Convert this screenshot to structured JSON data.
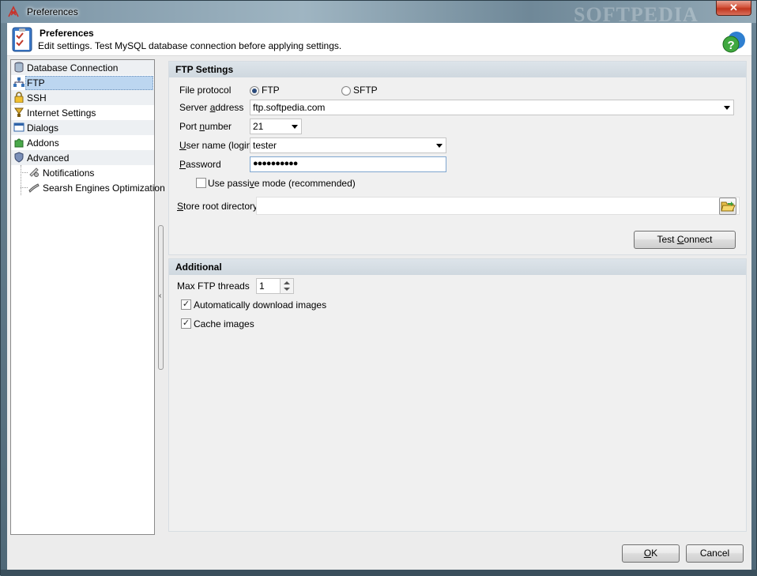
{
  "window": {
    "title": "Preferences",
    "watermark": "SOFTPEDIA",
    "close_label": "✕"
  },
  "header": {
    "title": "Preferences",
    "subtitle": "Edit settings. Test MySQL database connection before applying settings."
  },
  "sidebar": {
    "items": [
      {
        "label": "Database Connection",
        "icon": "database-icon"
      },
      {
        "label": "FTP",
        "icon": "network-icon",
        "selected": true
      },
      {
        "label": "SSH",
        "icon": "lock-icon"
      },
      {
        "label": "Internet Settings",
        "icon": "globe-icon"
      },
      {
        "label": "Dialogs",
        "icon": "dialog-icon"
      },
      {
        "label": "Addons",
        "icon": "puzzle-icon"
      },
      {
        "label": "Advanced",
        "icon": "shield-icon"
      },
      {
        "label": "Notifications",
        "icon": "notification-icon"
      },
      {
        "label": "Searsh Engines Optimization",
        "icon": "search-engine-icon"
      }
    ]
  },
  "ftp": {
    "heading": "FTP Settings",
    "protocol_label": "File protocol",
    "protocol_options": [
      "FTP",
      "SFTP"
    ],
    "protocol_selected": "FTP",
    "server_label_pre": "Server ",
    "server_label_u": "a",
    "server_label_post": "ddress",
    "server_value": "ftp.softpedia.com",
    "port_label_pre": "Port ",
    "port_label_u": "n",
    "port_label_post": "umber",
    "port_value": "21",
    "user_label_pre": "",
    "user_label_u": "U",
    "user_label_post": "ser name (login)",
    "user_value": "tester",
    "password_label_pre": "",
    "password_label_u": "P",
    "password_label_post": "assword",
    "password_value": "●●●●●●●●●●",
    "passive_label_pre": "Use passi",
    "passive_label_u": "v",
    "passive_label_post": "e mode (recommended)",
    "passive_checked": false,
    "store_label_pre": "",
    "store_label_u": "S",
    "store_label_post": "tore root directory",
    "store_value": "",
    "test_btn_pre": "Test ",
    "test_btn_u": "C",
    "test_btn_post": "onnect"
  },
  "additional": {
    "heading": "Additional",
    "threads_label": "Max FTP threads",
    "threads_value": "1",
    "auto_download_label": "Automatically download images",
    "auto_download_checked": true,
    "cache_label": "Cache images",
    "cache_checked": true
  },
  "footer": {
    "ok_u": "O",
    "ok_post": "K",
    "cancel_label": "Cancel"
  },
  "colors": {
    "selection": "#bcd6f0",
    "panel_head": "#cfd8df",
    "close_red": "#c0361e"
  }
}
